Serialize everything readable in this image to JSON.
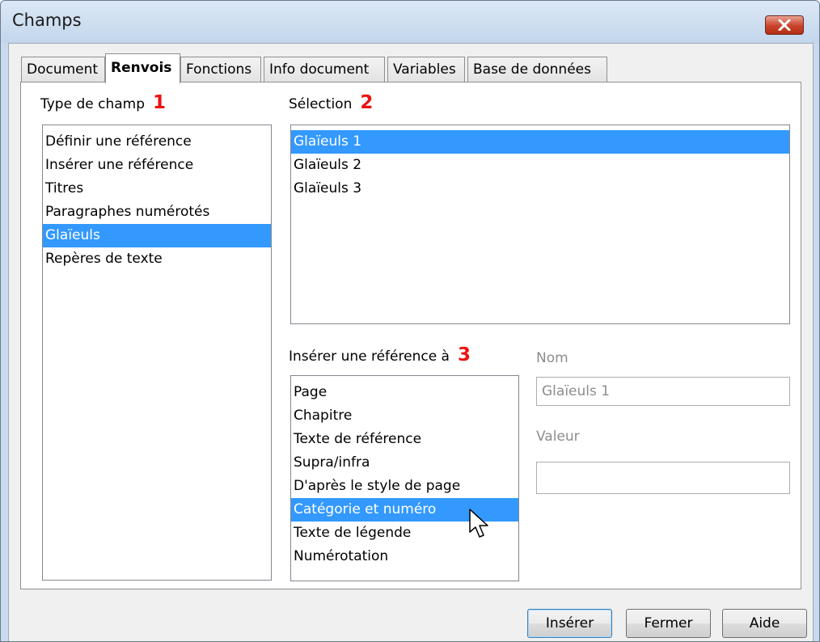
{
  "window": {
    "title": "Champs"
  },
  "tabs": [
    {
      "label": "Document"
    },
    {
      "label": "Renvois"
    },
    {
      "label": "Fonctions"
    },
    {
      "label": "Info document"
    },
    {
      "label": "Variables"
    },
    {
      "label": "Base de données"
    }
  ],
  "field_type": {
    "label": "Type de champ",
    "marker": "1",
    "items": [
      "Définir une référence",
      "Insérer une référence",
      "Titres",
      "Paragraphes numérotés",
      "Glaïeuls",
      "Repères de texte"
    ],
    "selected": "Glaïeuls"
  },
  "selection": {
    "label": "Sélection",
    "marker": "2",
    "items": [
      "Glaïeuls 1",
      "Glaïeuls 2",
      "Glaïeuls 3"
    ],
    "selected": "Glaïeuls 1"
  },
  "insert_ref": {
    "label": "Insérer une référence à",
    "marker": "3",
    "items": [
      "Page",
      "Chapitre",
      "Texte de référence",
      "Supra/infra",
      "D'après le style de page",
      "Catégorie et numéro",
      "Texte de légende",
      "Numérotation"
    ],
    "selected": "Catégorie et numéro"
  },
  "name_field": {
    "label": "Nom",
    "value": "Glaïeuls 1"
  },
  "value_field": {
    "label": "Valeur",
    "value": ""
  },
  "buttons": {
    "insert": "Insérer",
    "close": "Fermer",
    "help": "Aide"
  },
  "colors": {
    "selection": "#3399ff",
    "marker": "#ee1111",
    "close_button": "#c8432b"
  },
  "icons": {
    "close": "close-icon",
    "cursor": "mouse-pointer-icon"
  }
}
